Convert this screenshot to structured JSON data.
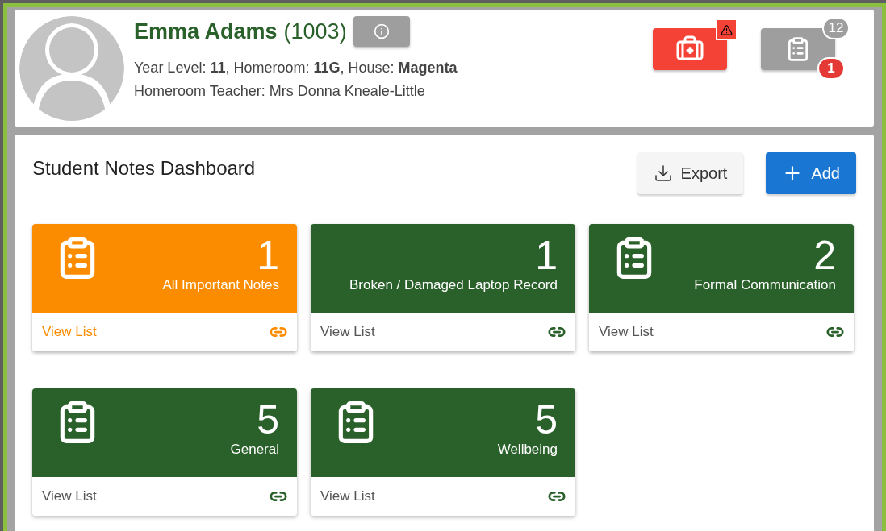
{
  "student": {
    "name": "Emma Adams",
    "id": "(1003)",
    "details": "Year Level: **11**, Homeroom: **11G**, House: **Magenta**",
    "teacher": "Homeroom Teacher: Mrs Donna Kneale-Little"
  },
  "alerts": {
    "medical_warning": true,
    "notes_count": "12",
    "important_count": "1"
  },
  "dashboard": {
    "title": "Student Notes Dashboard",
    "export_label": "Export",
    "add_label": "Add",
    "tiles": [
      {
        "count": "1",
        "label": "All Important Notes",
        "kind": "icon",
        "color": "#fb8c00",
        "link": "View List",
        "highlighted": true
      },
      {
        "count": "1",
        "label": "Broken / Damaged Laptop Record",
        "kind": "plain",
        "color": "#2a602a",
        "link": "View List",
        "highlighted": false
      },
      {
        "count": "2",
        "label": "Formal Communication",
        "kind": "icon",
        "color": "#2a602a",
        "link": "View List",
        "highlighted": false
      },
      {
        "count": "5",
        "label": "General",
        "kind": "icon",
        "color": "#2a602a",
        "link": "View List",
        "highlighted": false
      },
      {
        "count": "5",
        "label": "Wellbeing",
        "kind": "icon",
        "color": "#2a602a",
        "link": "View List",
        "highlighted": false
      }
    ]
  }
}
